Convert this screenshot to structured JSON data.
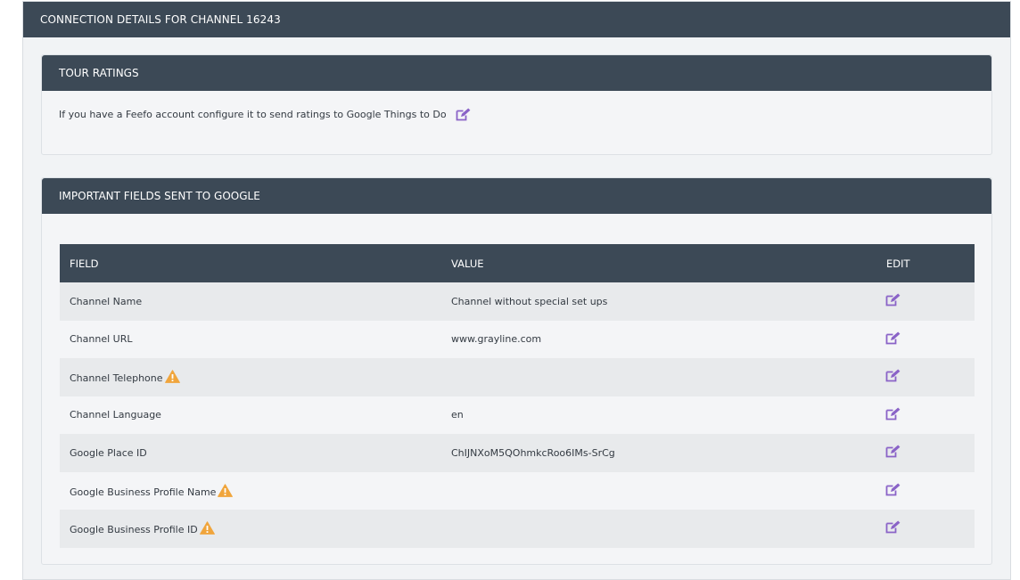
{
  "outer": {
    "title": "CONNECTION DETAILS FOR CHANNEL 16243"
  },
  "ratings": {
    "title": "TOUR RATINGS",
    "text": "If you have a Feefo account configure it to send ratings to Google Things to Do"
  },
  "fields": {
    "title": "IMPORTANT FIELDS SENT TO GOOGLE",
    "columns": {
      "field": "FIELD",
      "value": "VALUE",
      "edit": "EDIT"
    },
    "rows": [
      {
        "field": "Channel Name",
        "value": "Channel without special set ups",
        "warning": false
      },
      {
        "field": "Channel URL",
        "value": "www.grayline.com",
        "warning": false
      },
      {
        "field": "Channel Telephone",
        "value": "",
        "warning": true
      },
      {
        "field": "Channel Language",
        "value": "en",
        "warning": false
      },
      {
        "field": "Google Place ID",
        "value": "ChIJNXoM5QOhmkcRoo6IMs-SrCg",
        "warning": false
      },
      {
        "field": "Google Business Profile Name",
        "value": "",
        "warning": true
      },
      {
        "field": "Google Business Profile ID",
        "value": "",
        "warning": true
      }
    ]
  },
  "icons": {
    "edit": "edit-icon",
    "warning": "warning-icon"
  },
  "colors": {
    "header": "#3c4956",
    "edit_icon": "#8a63c7",
    "warning": "#f0a53c"
  }
}
